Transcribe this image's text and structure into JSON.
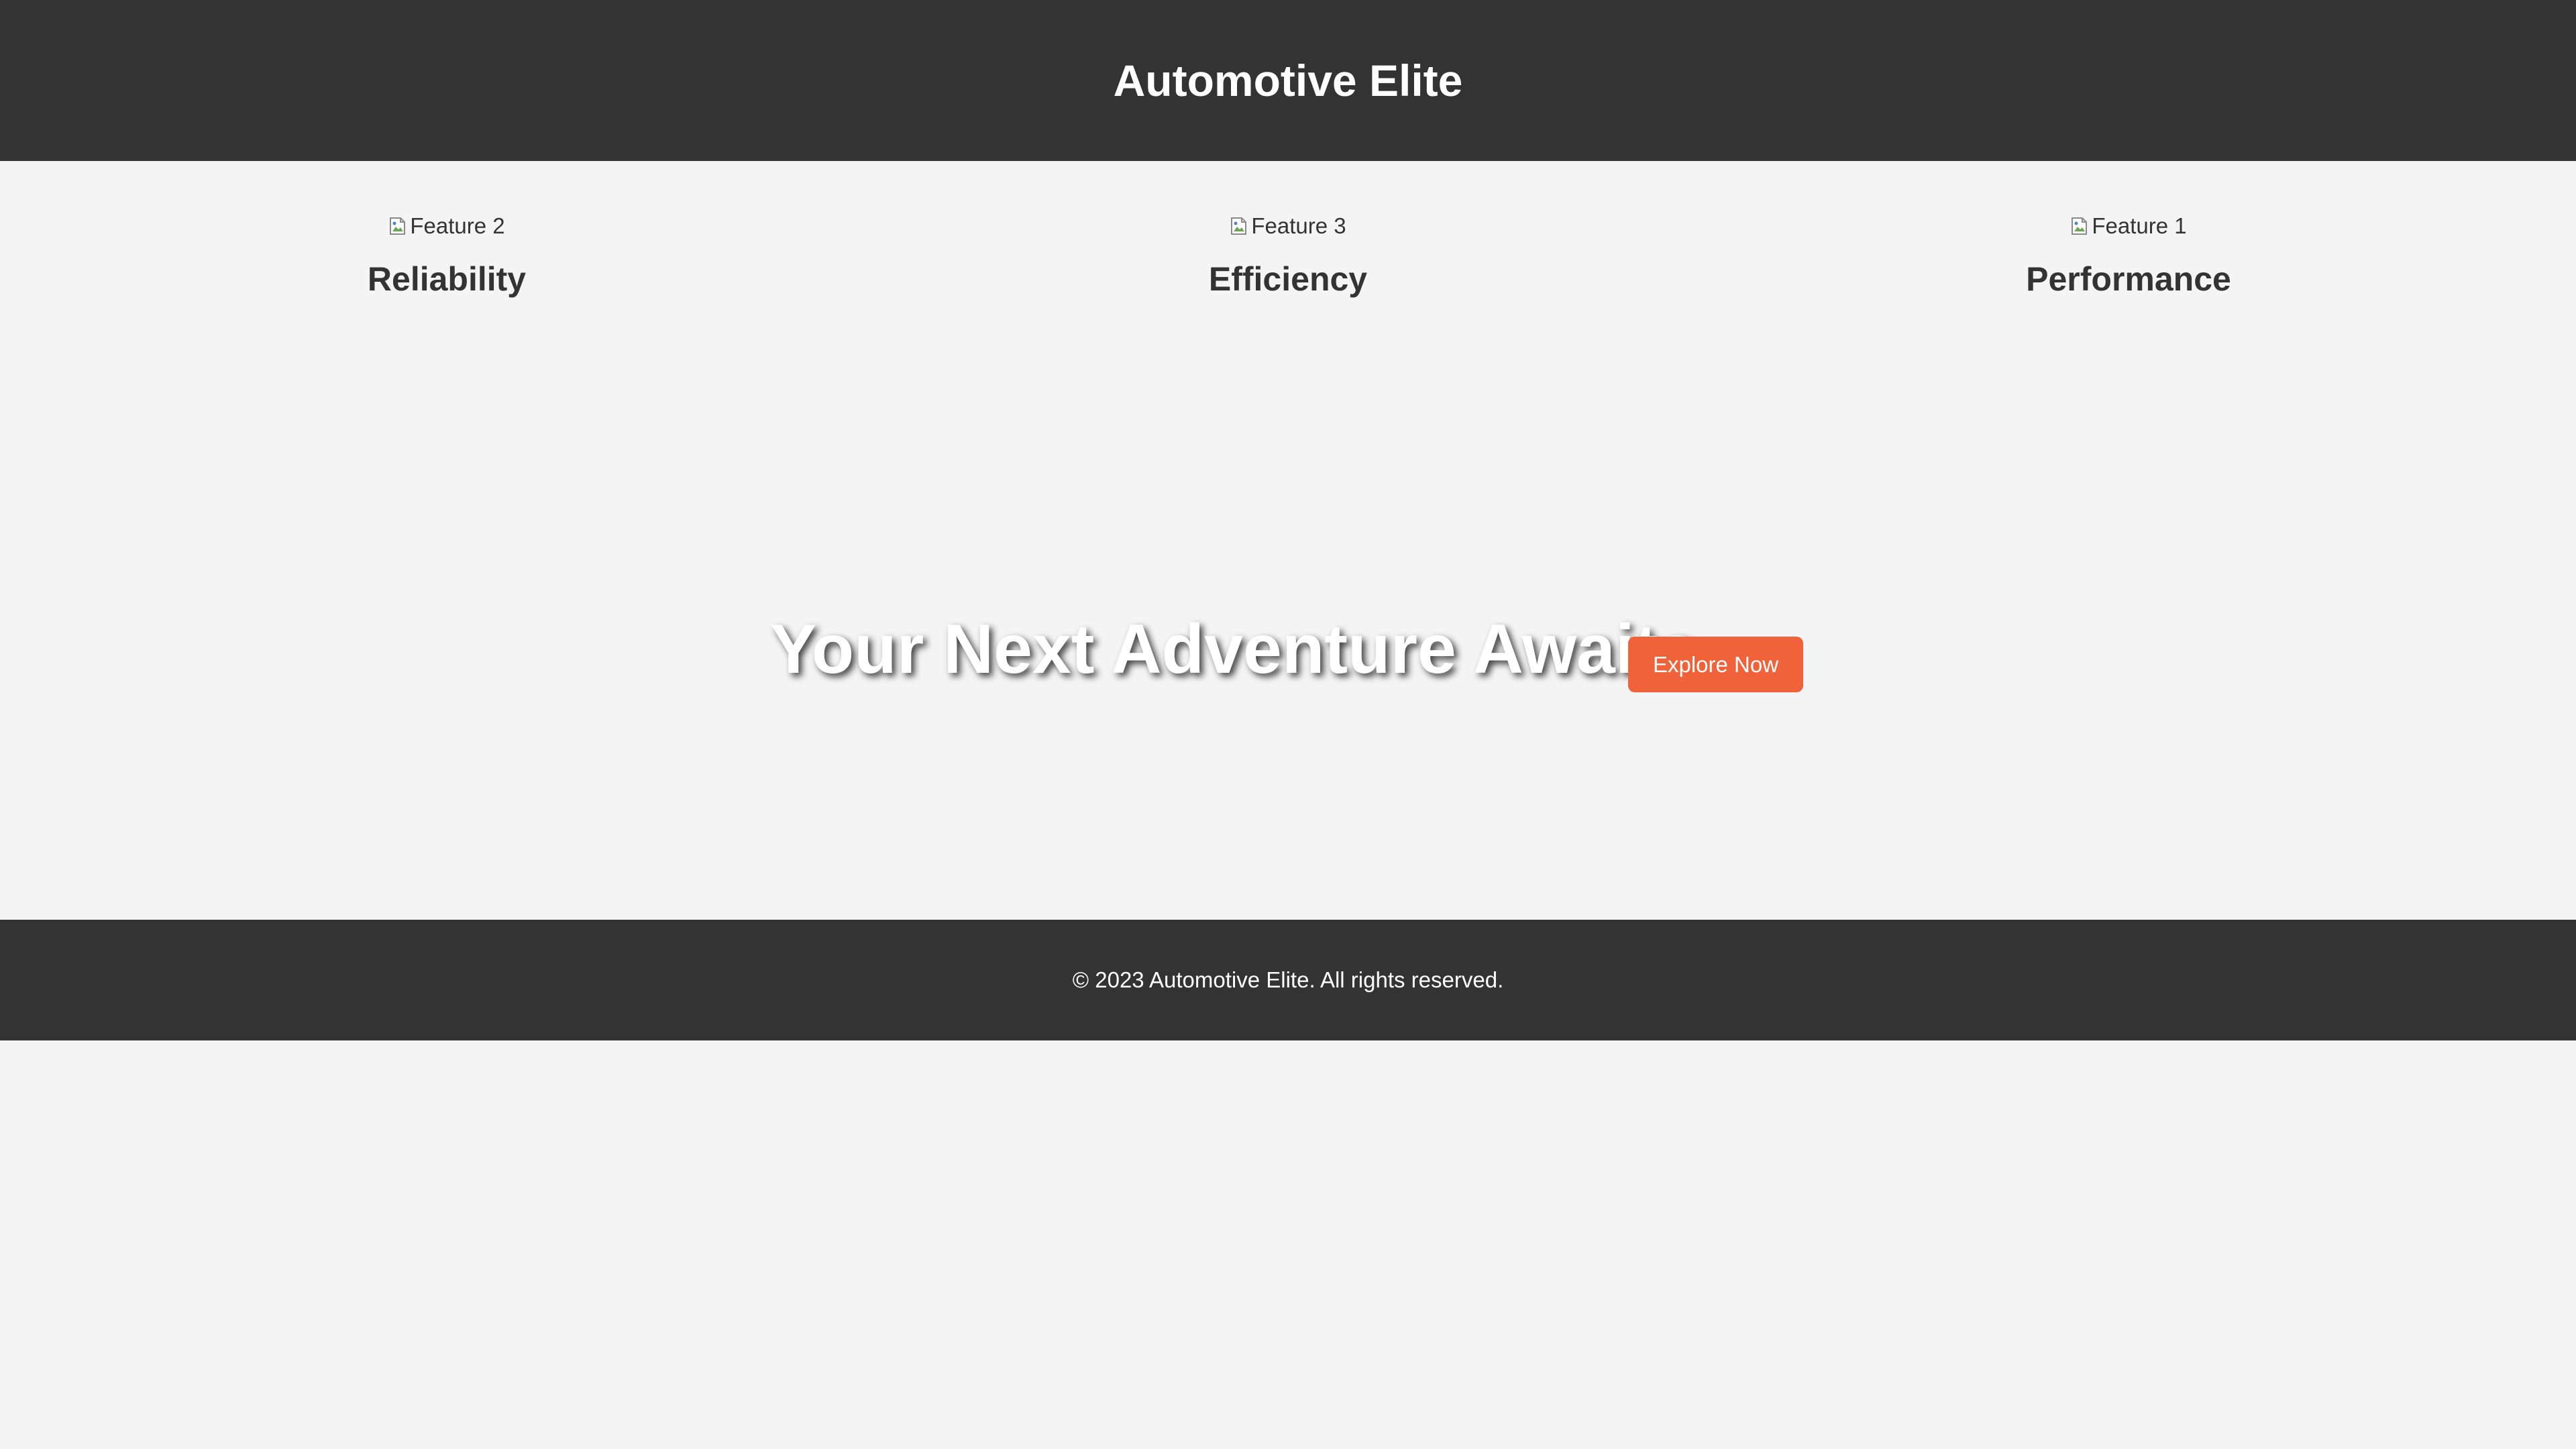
{
  "header": {
    "title": "Automotive Elite"
  },
  "features": [
    {
      "image_alt": "Feature 2",
      "title": "Reliability"
    },
    {
      "image_alt": "Feature 3",
      "title": "Efficiency"
    },
    {
      "image_alt": "Feature 1",
      "title": "Performance"
    }
  ],
  "hero": {
    "headline": "Your Next Adventure Awaits",
    "cta_label": "Explore Now"
  },
  "footer": {
    "copyright": "© 2023 Automotive Elite. All rights reserved."
  },
  "colors": {
    "header_bg": "#333333",
    "page_bg": "#f4f4f4",
    "accent": "#f0623a",
    "text": "#333333"
  },
  "icons": {
    "feature_image": "broken-image-icon"
  }
}
